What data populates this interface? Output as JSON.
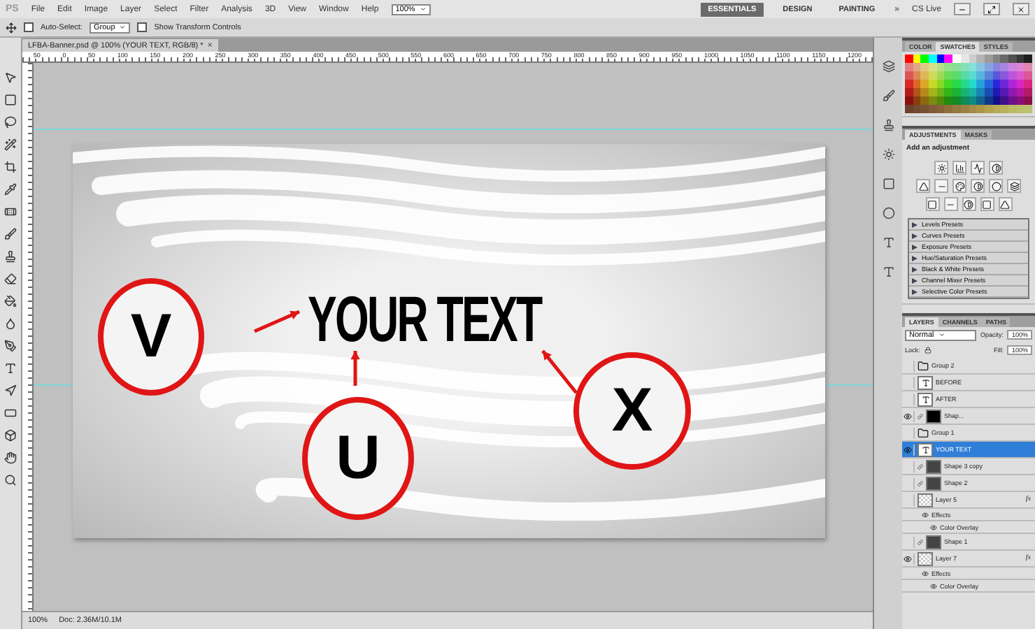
{
  "app_logo": "PS",
  "menu": [
    "File",
    "Edit",
    "Image",
    "Layer",
    "Select",
    "Filter",
    "Analysis",
    "3D",
    "View",
    "Window",
    "Help"
  ],
  "zoom_menu": "100%",
  "workspaces": [
    {
      "label": "ESSENTIALS",
      "selected": true
    },
    {
      "label": "DESIGN",
      "selected": false
    },
    {
      "label": "PAINTING",
      "selected": false
    }
  ],
  "more_workspaces": "»",
  "cs_live": "CS Live",
  "options_bar": {
    "auto_select": {
      "label": "Auto-Select:",
      "checked": false
    },
    "auto_select_target": "Group",
    "transform_controls": {
      "label": "Show Transform Controls",
      "checked": false
    }
  },
  "document_tab": {
    "title": "LFBA-Banner.psd @ 100% (YOUR TEXT, RGB/8) *",
    "close": "×"
  },
  "ruler_labels": [
    "50",
    "0",
    "50",
    "100",
    "150",
    "200",
    "250",
    "300",
    "350",
    "400",
    "450",
    "500",
    "550",
    "600",
    "650",
    "700",
    "750",
    "800",
    "850",
    "900",
    "950",
    "1000",
    "1050",
    "1100",
    "1150",
    "1200"
  ],
  "canvas": {
    "headline": "YOUR TEXT",
    "callouts": [
      {
        "letter": "V"
      },
      {
        "letter": "U"
      },
      {
        "letter": "X"
      }
    ]
  },
  "status_bar": {
    "zoom": "100%",
    "doc_size": "Doc: 2.36M/10.1M"
  },
  "swatch_panel": {
    "tabs": [
      {
        "label": "COLOR",
        "selected": false
      },
      {
        "label": "SWATCHES",
        "selected": true
      },
      {
        "label": "STYLES",
        "selected": false
      }
    ]
  },
  "adjustments_panel": {
    "tabs": [
      {
        "label": "ADJUSTMENTS",
        "selected": true
      },
      {
        "label": "MASKS",
        "selected": false
      }
    ],
    "heading": "Add an adjustment",
    "presets": [
      {
        "label": "Levels Presets",
        "expanded": false
      },
      {
        "label": "Curves Presets",
        "expanded": false
      },
      {
        "label": "Exposure Presets",
        "expanded": false
      },
      {
        "label": "Hue/Saturation Presets",
        "expanded": false
      },
      {
        "label": "Black & White Presets",
        "expanded": false
      },
      {
        "label": "Channel Mixer Presets",
        "expanded": false
      },
      {
        "label": "Selective Color Presets",
        "expanded": false
      }
    ]
  },
  "layers_panel": {
    "tabs": [
      {
        "label": "LAYERS",
        "selected": true
      },
      {
        "label": "CHANNELS",
        "selected": false
      },
      {
        "label": "PATHS",
        "selected": false
      }
    ],
    "blend_mode": "Normal",
    "opacity_label": "Opacity:",
    "opacity": "100%",
    "lock_label": "Lock:",
    "fill_label": "Fill:",
    "fill": "100%",
    "layers": [
      {
        "name": "Group 2",
        "kind": "group",
        "visible": false,
        "selected": false
      },
      {
        "name": "BEFORE",
        "kind": "text",
        "visible": false,
        "selected": false
      },
      {
        "name": "AFTER",
        "kind": "text",
        "visible": false,
        "selected": false
      },
      {
        "name": "Shap...",
        "kind": "masked",
        "visible": true,
        "selected": false
      },
      {
        "name": "Group 1",
        "kind": "group",
        "visible": false,
        "selected": false
      },
      {
        "name": "YOUR TEXT",
        "kind": "text",
        "visible": true,
        "selected": true
      },
      {
        "name": "Shape 3 copy",
        "kind": "shape",
        "visible": false,
        "selected": false
      },
      {
        "name": "Shape 2",
        "kind": "shape",
        "visible": false,
        "selected": false
      },
      {
        "name": "Layer 5",
        "kind": "pixel",
        "visible": false,
        "selected": false,
        "fx": "fx",
        "children": [
          {
            "name": "Effects",
            "children": [
              {
                "name": "Color Overlay"
              }
            ]
          }
        ]
      },
      {
        "name": "Shape 1",
        "kind": "shape",
        "visible": false,
        "selected": false
      },
      {
        "name": "Layer 7",
        "kind": "pixel",
        "visible": true,
        "selected": false,
        "fx": "fx",
        "children": [
          {
            "name": "Effects",
            "children": [
              {
                "name": "Color Overlay"
              }
            ]
          }
        ]
      }
    ]
  }
}
